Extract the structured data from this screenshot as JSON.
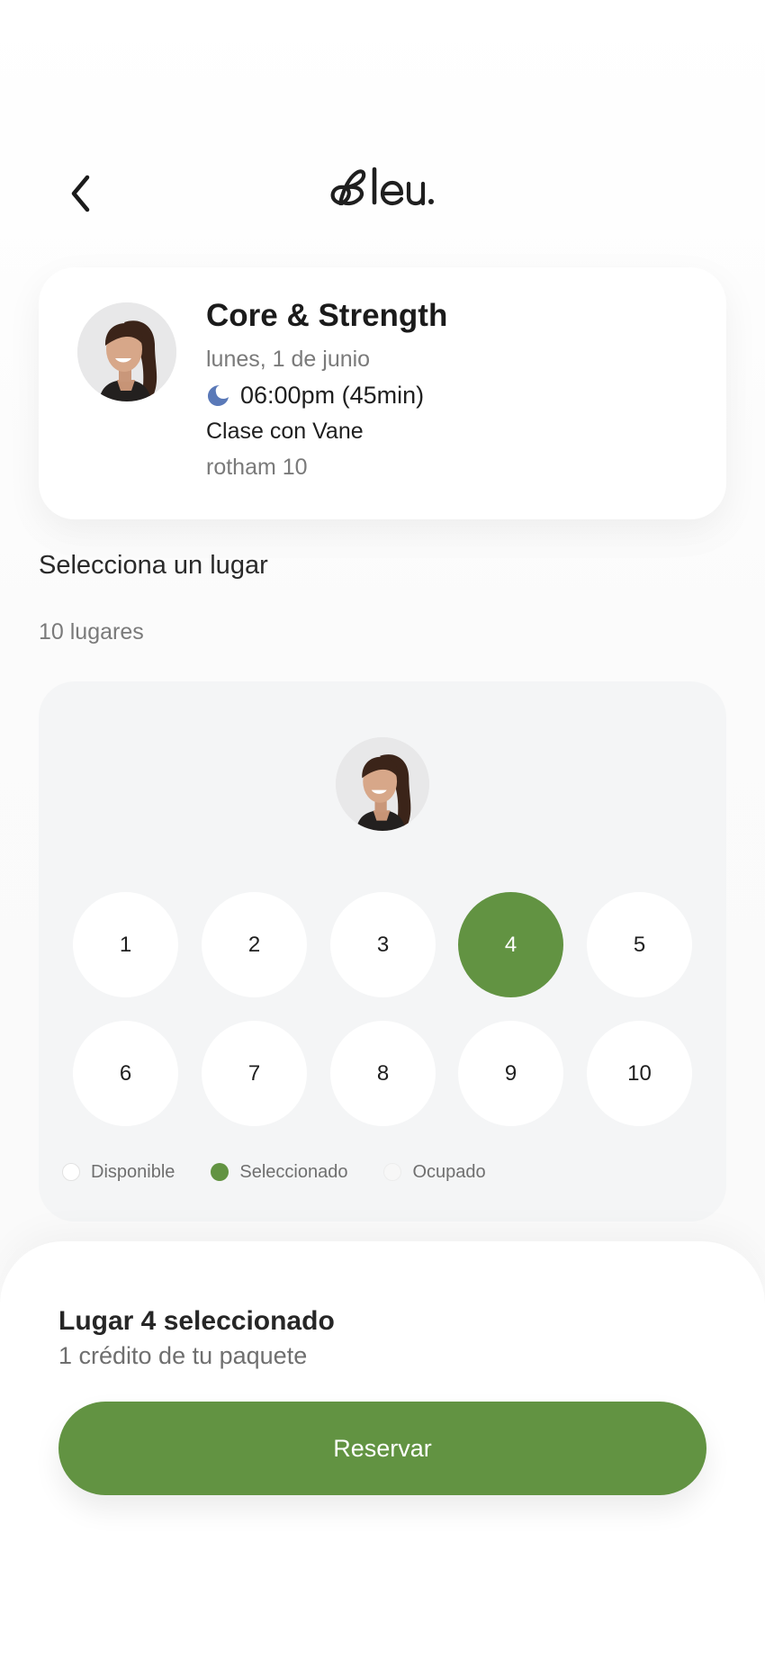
{
  "header": {
    "logo_text": "Bleu.",
    "back_icon": "chevron-left-icon"
  },
  "class_card": {
    "title": "Core & Strength",
    "date": "lunes, 1 de junio",
    "time": "06:00pm (45min)",
    "time_icon": "moon-icon",
    "instructor": "Clase con Vane",
    "location": "rotham 10"
  },
  "section": {
    "title": "Selecciona un lugar",
    "spots_count": "10 lugares"
  },
  "spots": [
    {
      "label": "1",
      "state": "available"
    },
    {
      "label": "2",
      "state": "available"
    },
    {
      "label": "3",
      "state": "available"
    },
    {
      "label": "4",
      "state": "selected"
    },
    {
      "label": "5",
      "state": "available"
    },
    {
      "label": "6",
      "state": "available"
    },
    {
      "label": "7",
      "state": "available"
    },
    {
      "label": "8",
      "state": "available"
    },
    {
      "label": "9",
      "state": "available"
    },
    {
      "label": "10",
      "state": "available"
    }
  ],
  "legend": {
    "available": "Disponible",
    "selected": "Seleccionado",
    "occupied": "Ocupado"
  },
  "bottom_sheet": {
    "title": "Lugar 4 seleccionado",
    "subtitle": "1 crédito de tu paquete",
    "button_label": "Reservar"
  },
  "colors": {
    "accent": "#629342",
    "moon_icon": "#5a79b8",
    "panel_bg": "#f4f5f6"
  }
}
